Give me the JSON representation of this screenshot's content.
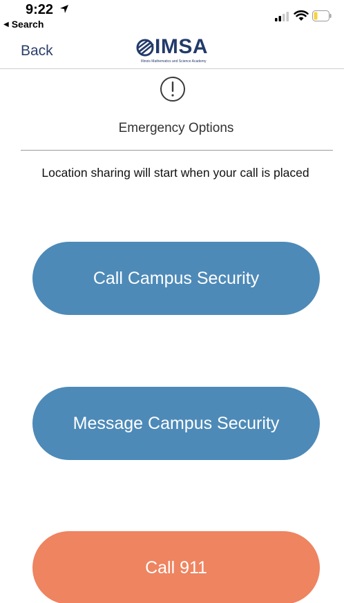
{
  "status_bar": {
    "time": "9:22",
    "back_app": "Search",
    "icons": [
      "location-arrow-icon",
      "signal-icon",
      "wifi-icon",
      "battery-icon"
    ],
    "battery_color": "#f5d33b"
  },
  "nav": {
    "back_label": "Back",
    "logo_text": "IMSA",
    "logo_subtitle": "Illinois Mathematics and Science Academy"
  },
  "header": {
    "icon": "exclamation-circle-icon",
    "title": "Emergency Options"
  },
  "notice": "Location sharing will start when your call is placed",
  "actions": {
    "call_security": "Call Campus Security",
    "message_security": "Message Campus Security",
    "call_911": "Call 911"
  },
  "colors": {
    "primary_button": "#4d8ab8",
    "emergency_button": "#ee8460",
    "brand": "#233a6a"
  }
}
